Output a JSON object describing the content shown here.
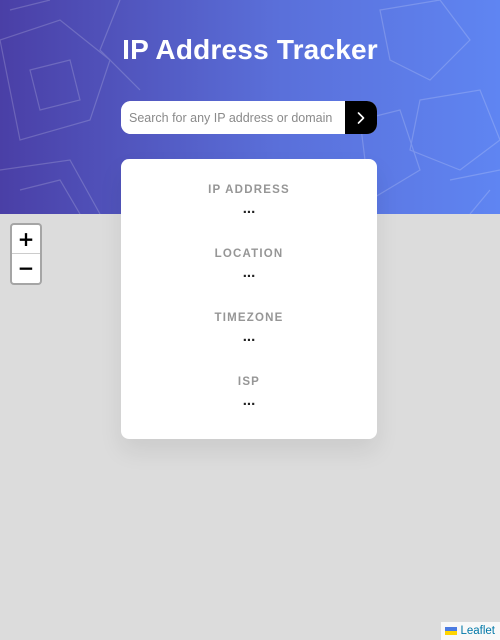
{
  "header": {
    "title": "IP Address Tracker",
    "gradient_colors": [
      "#4a3fa6",
      "#5a6fd9",
      "#5f85f2"
    ]
  },
  "search": {
    "placeholder": "Search for any IP address or domain",
    "value": "",
    "submit_icon": "chevron-right-icon"
  },
  "info": [
    {
      "label": "IP ADDRESS",
      "value": "..."
    },
    {
      "label": "LOCATION",
      "value": "..."
    },
    {
      "label": "TIMEZONE",
      "value": "..."
    },
    {
      "label": "ISP",
      "value": "..."
    }
  ],
  "map": {
    "background": "#dcdcdc",
    "zoom_in": "+",
    "zoom_out": "−",
    "attribution": "Leaflet",
    "attribution_icon": "ukraine-flag-icon"
  }
}
